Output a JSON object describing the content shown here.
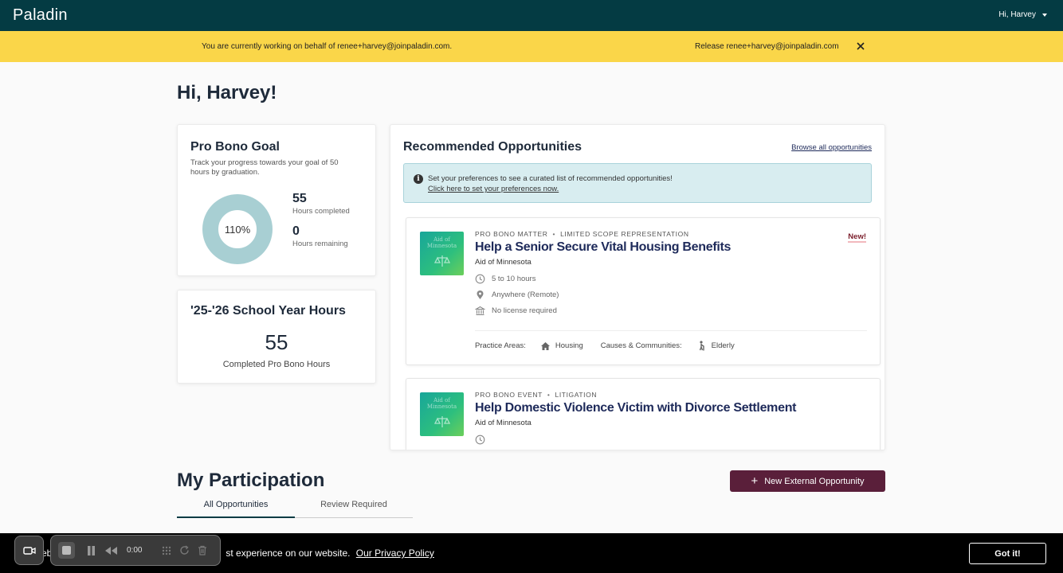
{
  "topbar": {
    "logo": "Paladin",
    "user_greeting": "Hi, Harvey"
  },
  "banner": {
    "message": "You are currently working on behalf of renee+harvey@joinpaladin.com.",
    "release_label": "Release renee+harvey@joinpaladin.com"
  },
  "greeting": "Hi, Harvey!",
  "goal": {
    "title": "Pro Bono Goal",
    "description": "Track your progress towards your goal of 50 hours by graduation.",
    "percent_label": "110%",
    "progress_fraction": 1.0,
    "completed_value": "55",
    "completed_label": "Hours completed",
    "remaining_value": "0",
    "remaining_label": "Hours remaining"
  },
  "school_year": {
    "title": "'25-'26 School Year Hours",
    "value": "55",
    "label": "Completed Pro Bono Hours"
  },
  "recommended": {
    "title": "Recommended Opportunities",
    "browse_link": "Browse all opportunities",
    "prefs_text": "Set your preferences to see a curated list of recommended opportunities!",
    "prefs_link": "Click here to set your preferences now.",
    "opportunities": [
      {
        "type": "PRO BONO MATTER",
        "subtype": "LIMITED SCOPE REPRESENTATION",
        "title": "Help a Senior Secure Vital Housing Benefits",
        "org": "Aid of Minnesota",
        "badge": "New!",
        "thumb_text": "Aid of Minnesota",
        "hours": "5 to 10 hours",
        "location": "Anywhere (Remote)",
        "license": "No license required",
        "practice_areas_label": "Practice Areas:",
        "practice_area": "Housing",
        "causes_label": "Causes & Communities:",
        "cause": "Elderly"
      },
      {
        "type": "PRO BONO EVENT",
        "subtype": "LITIGATION",
        "title": "Help Domestic Violence Victim with Divorce Settlement",
        "org": "Aid of Minnesota",
        "thumb_text": "Aid of Minnesota"
      }
    ]
  },
  "participation": {
    "title": "My Participation",
    "new_button": "New External Opportunity",
    "tabs": [
      "All Opportunities",
      "Review Required"
    ]
  },
  "cookie": {
    "text_fragment": "eb",
    "text_rest": "st experience on our website.",
    "policy_link": "Our Privacy Policy",
    "button": "Got it!"
  },
  "recorder": {
    "time": "0:00"
  },
  "colors": {
    "topbar": "#043b43",
    "banner": "#fad649",
    "donut": "#a8cfd3",
    "button": "#5a1f3a"
  },
  "icons": [
    "camera-icon",
    "stop-icon",
    "pause-icon",
    "rewind-icon",
    "grid-icon",
    "refresh-icon",
    "trash-icon",
    "clock-icon",
    "location-pin-icon",
    "building-icon",
    "house-icon",
    "person-cane-icon",
    "info-icon",
    "close-icon",
    "plus-icon",
    "chevron-down-icon"
  ]
}
